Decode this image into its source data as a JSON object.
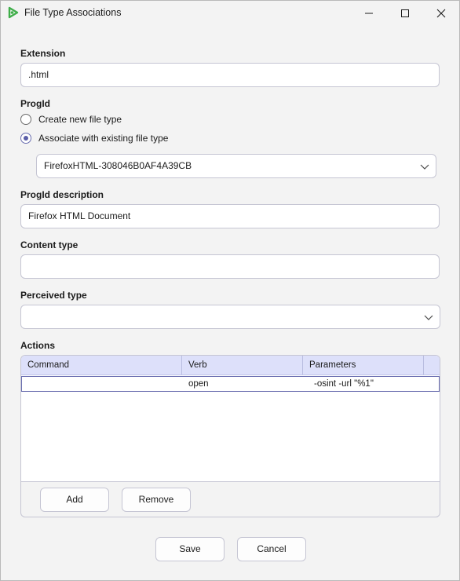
{
  "window": {
    "title": "File Type Associations"
  },
  "extension": {
    "label": "Extension",
    "value": ".html"
  },
  "progid": {
    "label": "ProgId",
    "options": [
      {
        "label": "Create new file type",
        "checked": false
      },
      {
        "label": "Associate with existing file type",
        "checked": true
      }
    ],
    "selected": "FirefoxHTML-308046B0AF4A39CB"
  },
  "progid_description": {
    "label": "ProgId description",
    "value": "Firefox HTML Document"
  },
  "content_type": {
    "label": "Content type",
    "value": ""
  },
  "perceived_type": {
    "label": "Perceived type",
    "value": ""
  },
  "actions": {
    "label": "Actions",
    "columns": [
      "Command",
      "Verb",
      "Parameters"
    ],
    "rows": [
      {
        "command": "",
        "verb": "open",
        "parameters": "-osint -url \"%1\""
      }
    ],
    "add_label": "Add",
    "remove_label": "Remove"
  },
  "footer": {
    "save_label": "Save",
    "cancel_label": "Cancel"
  },
  "colors": {
    "accent": "#5a5ea8",
    "header_bg": "#dde0fa",
    "icon_green": "#3fae49"
  }
}
